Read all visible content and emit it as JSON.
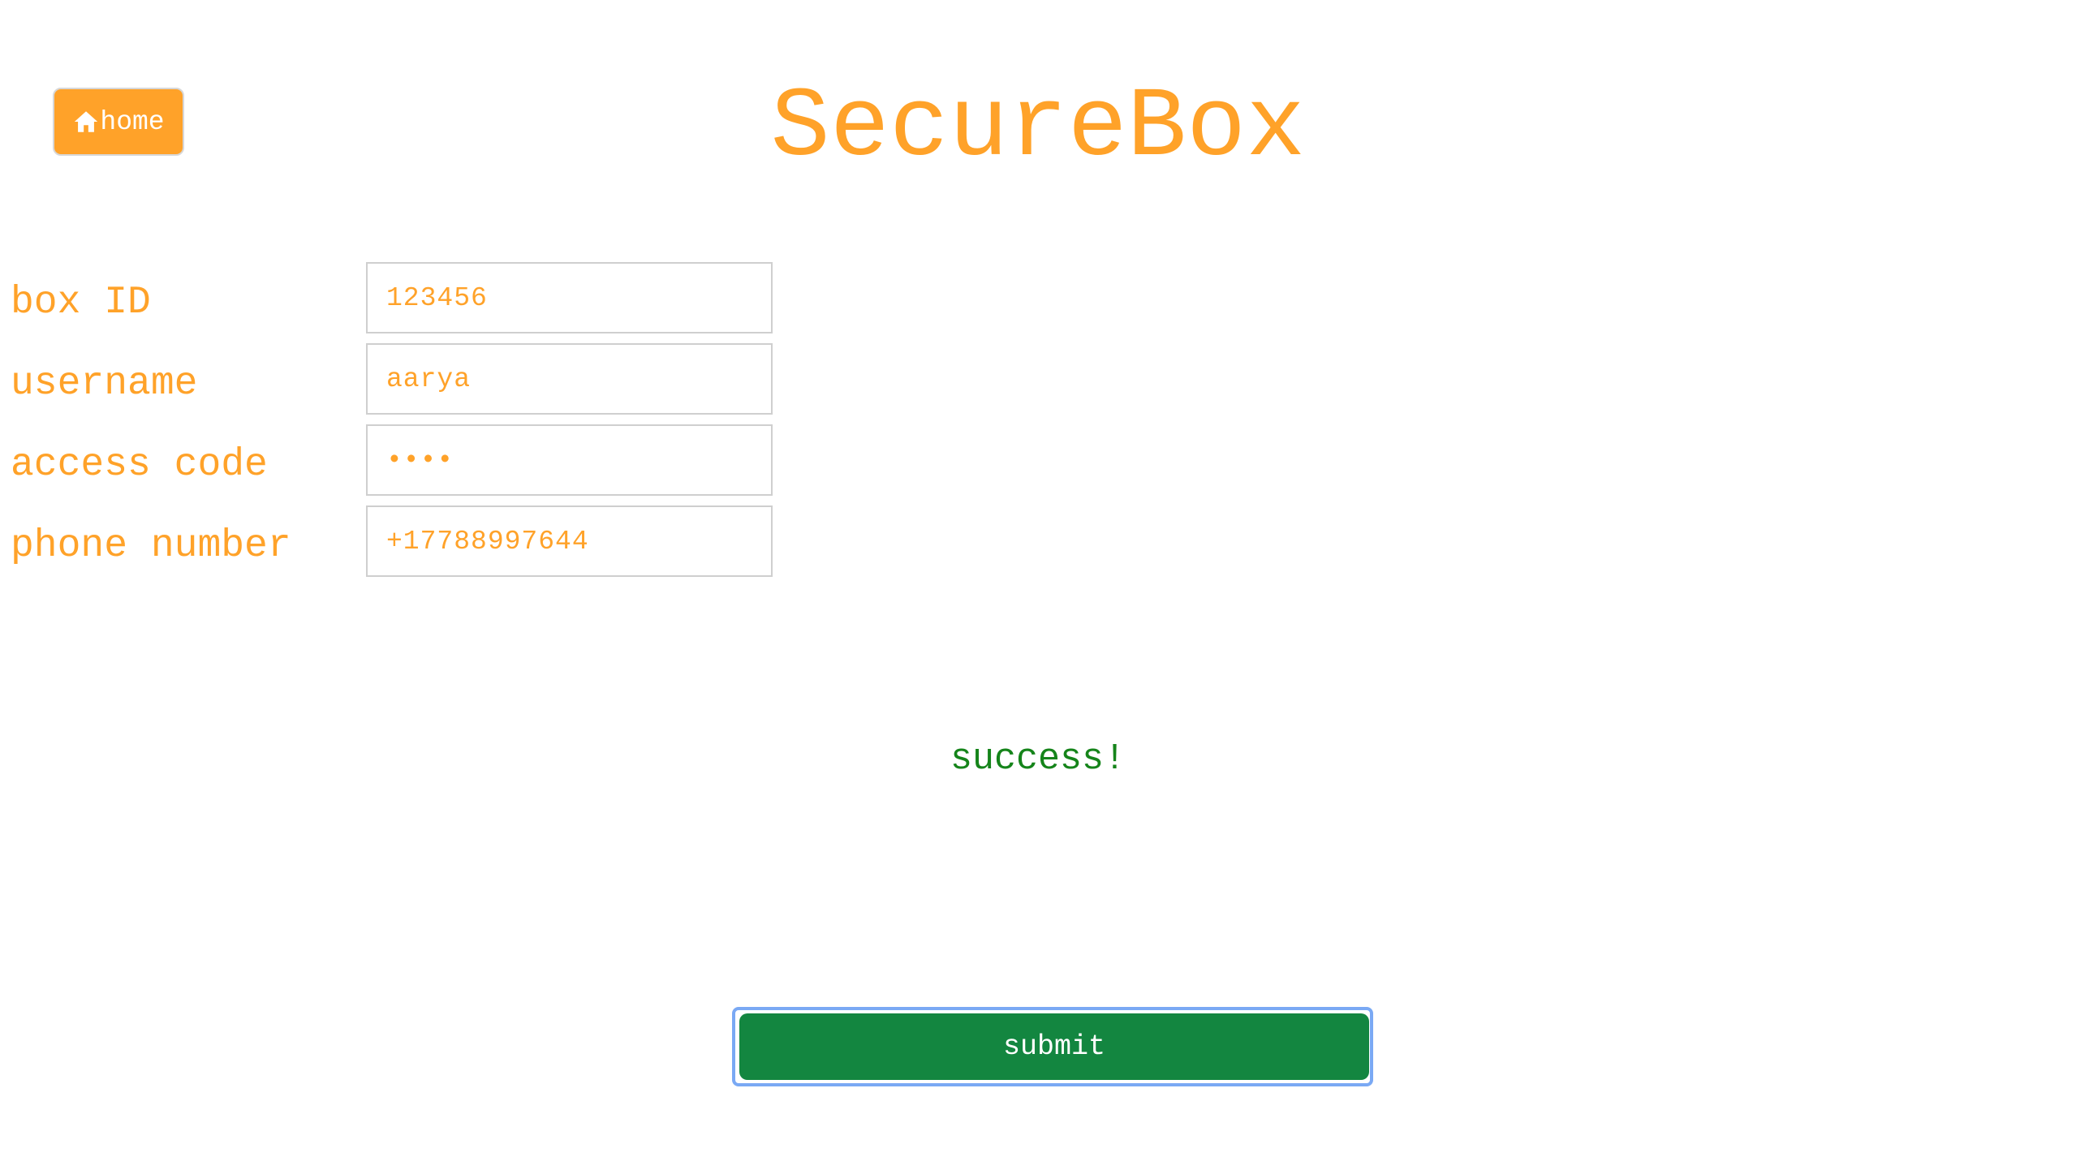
{
  "header": {
    "home_label": "home",
    "home_icon": "home-icon",
    "title": "SecureBox"
  },
  "form": {
    "fields": [
      {
        "label": "box ID",
        "value": "123456",
        "type": "text"
      },
      {
        "label": "username",
        "value": "aarya",
        "type": "text"
      },
      {
        "label": "access code",
        "value": "••••",
        "type": "password"
      },
      {
        "label": "phone number",
        "value": "+17788997644",
        "type": "tel"
      }
    ]
  },
  "status": {
    "message": "success!"
  },
  "actions": {
    "submit_label": "submit"
  },
  "colors": {
    "accent": "#ffa229",
    "success": "#15841a",
    "submit": "#138640",
    "focus_ring": "#7aa9f4"
  }
}
